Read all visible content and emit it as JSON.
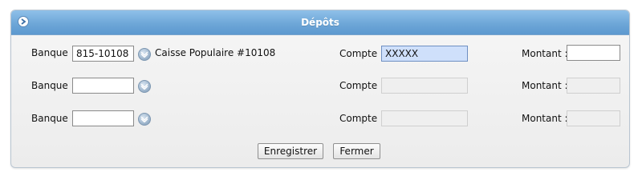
{
  "panel": {
    "title": "Dépôts"
  },
  "rows": [
    {
      "bank_label": "Banque :",
      "bank_value": "815-10108",
      "bank_name": "Caisse Populaire #10108",
      "account_label": "Compte :",
      "account_value": "XXXXX",
      "amount_label": "Montant :",
      "amount_value": ""
    },
    {
      "bank_label": "Banque :",
      "bank_value": "",
      "bank_name": "",
      "account_label": "Compte :",
      "account_value": "",
      "amount_label": "Montant :",
      "amount_value": ""
    },
    {
      "bank_label": "Banque :",
      "bank_value": "",
      "bank_name": "",
      "account_label": "Compte :",
      "account_value": "",
      "amount_label": "Montant :",
      "amount_value": ""
    }
  ],
  "buttons": {
    "save_label": "Enregistrer",
    "close_label": "Fermer"
  },
  "colors": {
    "header": "#6ea7d8",
    "selected_field": "#cfe0fb"
  }
}
